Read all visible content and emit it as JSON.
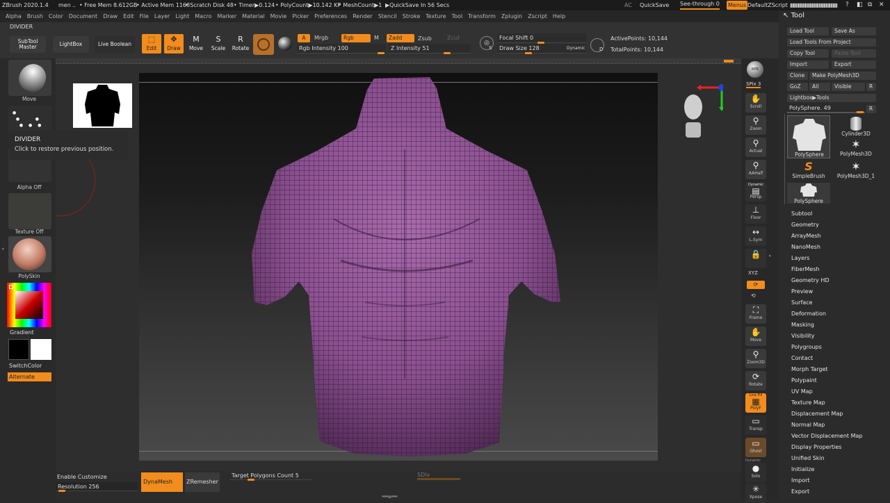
{
  "titlebar": {
    "app": "ZBrush 2020.1.4",
    "items": [
      "men",
      "..",
      "• Free Mem 8.612GB",
      "• Active Mem 1168",
      "• Scratch Disk 48",
      "• Timer▶0.124",
      "• PolyCount▶10.142 KP",
      "• MeshCount▶1",
      "▶QuickSave In 56 Secs"
    ],
    "ac": "AC",
    "quicksave": "QuickSave",
    "see_through": "See-through",
    "see_through_value": "0",
    "menus": "Menus",
    "script": "DefaultZScript"
  },
  "menus": [
    "Alpha",
    "Brush",
    "Color",
    "Document",
    "Draw",
    "Edit",
    "File",
    "Layer",
    "Light",
    "Macro",
    "Marker",
    "Material",
    "Movie",
    "Picker",
    "Preferences",
    "Render",
    "Stencil",
    "Stroke",
    "Texture",
    "Tool",
    "Transform",
    "Zplugin",
    "Zscript",
    "Help"
  ],
  "divider_label": "DIVIDER",
  "shelf": {
    "subtool_master": [
      "SubTool",
      "Master"
    ],
    "lightbox": "LightBox",
    "live_boolean": "Live Boolean",
    "edit": "Edit",
    "draw": "Draw",
    "move": "Move",
    "scale": "Scale",
    "rotate": "Rotate",
    "a": "A",
    "mrgb": "Mrgb",
    "rgb": "Rgb",
    "m": "M",
    "zadd": "Zadd",
    "zsub": "Zsub",
    "zcut": "Zcut",
    "rgb_intensity_label": "Rgb Intensity",
    "rgb_intensity": "100",
    "z_intensity_label": "Z Intensity",
    "z_intensity": "51",
    "focal_shift_label": "Focal Shift",
    "focal_shift": "0",
    "draw_size_label": "Draw Size",
    "draw_size": "128",
    "dynamic": "Dynamic",
    "active_points": "ActivePoints: 10,144",
    "total_points": "TotalPoints: 10,144",
    "s_key": "S",
    "d_key": "D"
  },
  "left": {
    "move": "Move",
    "alpha_off": "Alpha Off",
    "texture_off": "Texture Off",
    "polyskin": "PolySkin",
    "gradient": "Gradient",
    "switchcolor": "SwitchColor",
    "alternate": "Alternate"
  },
  "tooltip": {
    "title": "DIVIDER",
    "text": "Click to restore previous position."
  },
  "rightshelf": [
    "BPR",
    "SPix 3",
    "Scroll",
    "Zoom",
    "Actual",
    "AAHalf",
    "Persp",
    "Floor",
    "L.Sym",
    "",
    "XYZ",
    "",
    "",
    "Frame",
    "Move",
    "Zoom3D",
    "Rotate",
    "PolyF",
    "Transp",
    "Ghost",
    "Solo",
    "Xpose"
  ],
  "rightshelf_extra": {
    "dynamic": "Dynamic",
    "line_fill": "Line Fill"
  },
  "tool": {
    "title": "Tool",
    "load_tool": "Load Tool",
    "save_as": "Save As",
    "load_from_project": "Load Tools From Project",
    "copy_tool": "Copy Tool",
    "paste_tool": "Paste Tool",
    "import": "Import",
    "export": "Export",
    "clone": "Clone",
    "make_polymesh": "Make PolyMesh3D",
    "goz": "GoZ",
    "all": "All",
    "visible": "Visible",
    "r": "R",
    "lightbox_tools": "Lightbox▶Tools",
    "current": "PolySphere. 49",
    "thumbs": [
      "PolySphere",
      "Cylinder3D",
      "PolyMesh3D",
      "SimpleBrush",
      "PolyMesh3D_1",
      "PolySphere"
    ],
    "menu": [
      "Subtool",
      "Geometry",
      "ArrayMesh",
      "NanoMesh",
      "Layers",
      "FiberMesh",
      "Geometry HD",
      "Preview",
      "Surface",
      "Deformation",
      "Masking",
      "Visibility",
      "Polygroups",
      "Contact",
      "Morph Target",
      "Polypaint",
      "UV Map",
      "Texture Map",
      "Displacement Map",
      "Normal Map",
      "Vector Displacement Map",
      "Display Properties",
      "Unified Skin",
      "Initialize",
      "Import",
      "Export"
    ]
  },
  "bottom": {
    "enable_customize": "Enable Customize",
    "resolution_label": "Resolution",
    "resolution": "256",
    "dynamesh": "DynaMesh",
    "zremesher": "ZRemesher",
    "target_label": "Target Polygons Count",
    "target": "5",
    "sdiv": "SDiv"
  },
  "colors": {
    "accent": "#f28c1c",
    "mesh": "#8a4f8f"
  }
}
